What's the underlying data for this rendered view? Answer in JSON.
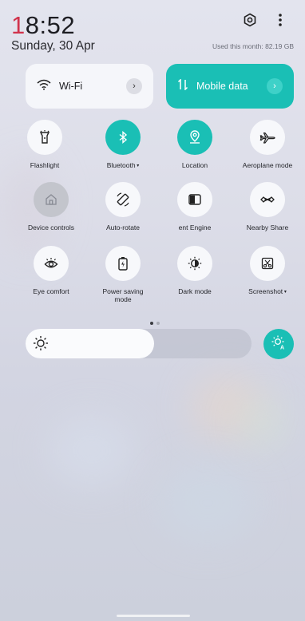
{
  "status": {
    "time_prefix": "1",
    "time_rest": "8:52",
    "date": "Sunday, 30 Apr",
    "data_usage": "Used this month: 82.19 GB"
  },
  "header": {
    "settings_icon": "settings-hex-icon",
    "more_icon": "more-vertical-icon"
  },
  "large_tiles": [
    {
      "label": "Wi-Fi",
      "icon": "wifi-icon",
      "active": false
    },
    {
      "label": "Mobile data",
      "icon": "mobile-data-icon",
      "active": true
    }
  ],
  "quick_settings": [
    {
      "label": "Flashlight",
      "icon": "flashlight-icon",
      "state": "off"
    },
    {
      "label": "Bluetooth",
      "icon": "bluetooth-icon",
      "state": "on",
      "has_menu": true
    },
    {
      "label": "Location",
      "icon": "location-icon",
      "state": "on"
    },
    {
      "label": "Aeroplane mode",
      "icon": "airplane-icon",
      "state": "off"
    },
    {
      "label": "Device controls",
      "icon": "home-icon",
      "state": "disabled"
    },
    {
      "label": "Auto-rotate",
      "icon": "auto-rotate-icon",
      "state": "off"
    },
    {
      "label": "ent Engine",
      "icon": "engine-icon",
      "state": "off"
    },
    {
      "label": "Nearby Share",
      "icon": "nearby-share-icon",
      "state": "off"
    },
    {
      "label": "Eye comfort",
      "icon": "eye-comfort-icon",
      "state": "off"
    },
    {
      "label": "Power saving mode",
      "icon": "power-saving-icon",
      "state": "off"
    },
    {
      "label": "Dark mode",
      "icon": "dark-mode-icon",
      "state": "off"
    },
    {
      "label": "Screenshot",
      "icon": "screenshot-icon",
      "state": "off",
      "has_menu": true
    }
  ],
  "page_indicator": {
    "pages": 2,
    "current": 1
  },
  "brightness": {
    "level": 0.57,
    "auto_icon": "auto-brightness-icon"
  },
  "colors": {
    "accent": "#1abfb5",
    "time_red": "#d1334c"
  }
}
